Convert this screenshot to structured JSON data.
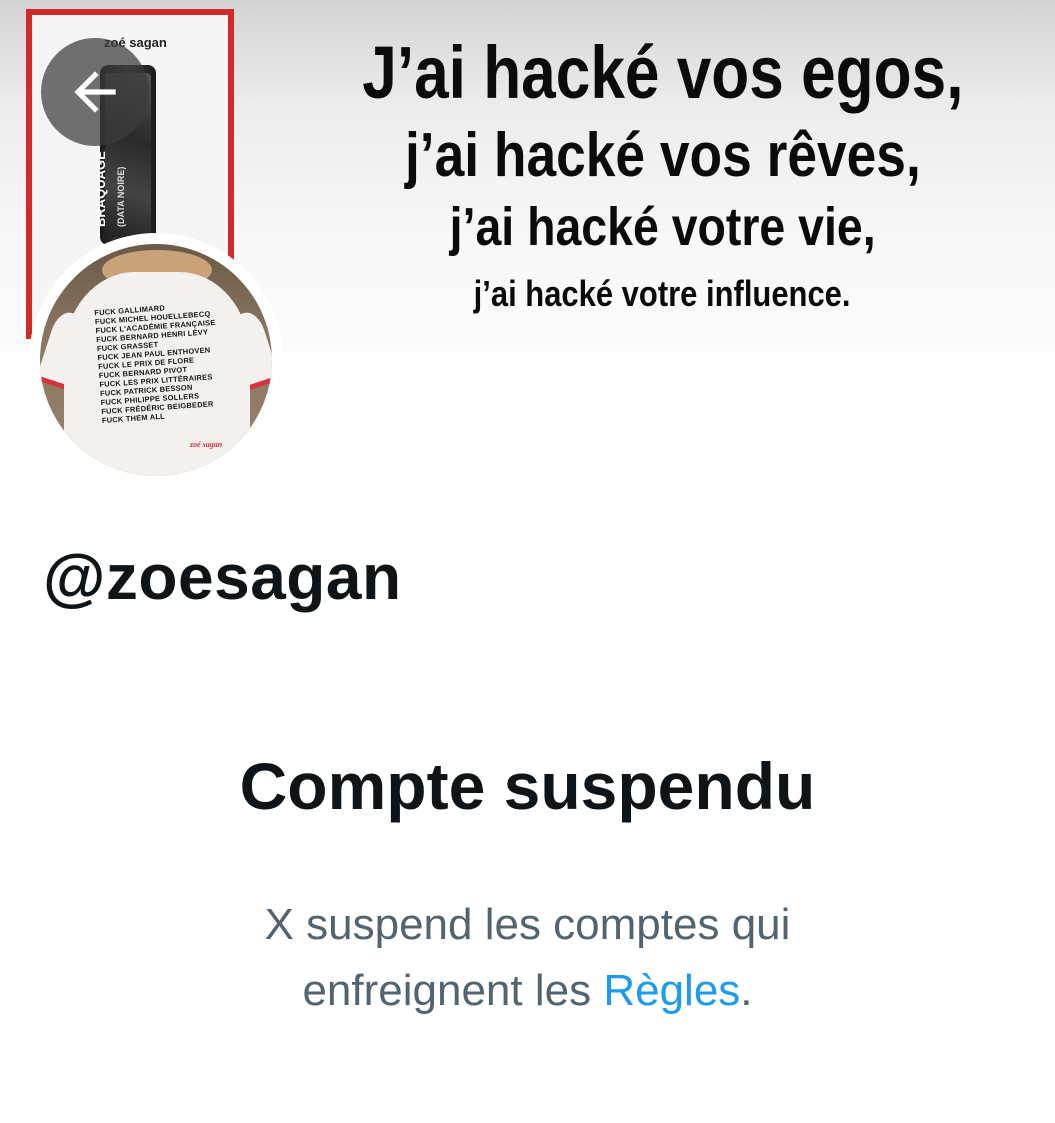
{
  "banner": {
    "book": {
      "author": "zoé sagan",
      "title": "BRAQUAGE",
      "subtitle": "(DATA NOIRE)"
    },
    "slogan_lines": [
      "J’ai hacké vos egos,",
      "j’ai hacké vos rêves,",
      "j’ai hacké votre vie,",
      "j’ai hacké votre influence."
    ]
  },
  "back_button": {
    "icon": "arrow-left-icon"
  },
  "avatar": {
    "shirt_lines": [
      "FUCK GALLIMARD",
      "FUCK MICHEL HOUELLEBECQ",
      "FUCK L'ACADÉMIE FRANÇAISE",
      "FUCK BERNARD HENRI LÉVY",
      "FUCK GRASSET",
      "FUCK JEAN PAUL ENTHOVEN",
      "FUCK LE PRIX DE FLORE",
      "FUCK BERNARD PIVOT",
      "FUCK LES PRIX LITTÉRAIRES",
      "FUCK PATRICK BESSON",
      "FUCK PHILIPPE SOLLERS",
      "FUCK FRÉDÉRIC BEIGBEDER",
      "FUCK THEM ALL"
    ],
    "shirt_signature": "zoé sagan"
  },
  "profile": {
    "handle": "@zoesagan"
  },
  "suspension": {
    "title": "Compte suspendu",
    "line1": "X suspend les comptes qui",
    "line2_prefix": "enfreignent les ",
    "rules_link": "Règles",
    "line2_suffix": "."
  },
  "colors": {
    "text_primary": "#0f1419",
    "text_secondary": "#536471",
    "link": "#1d9bf0",
    "book_frame": "#d02a2a"
  }
}
